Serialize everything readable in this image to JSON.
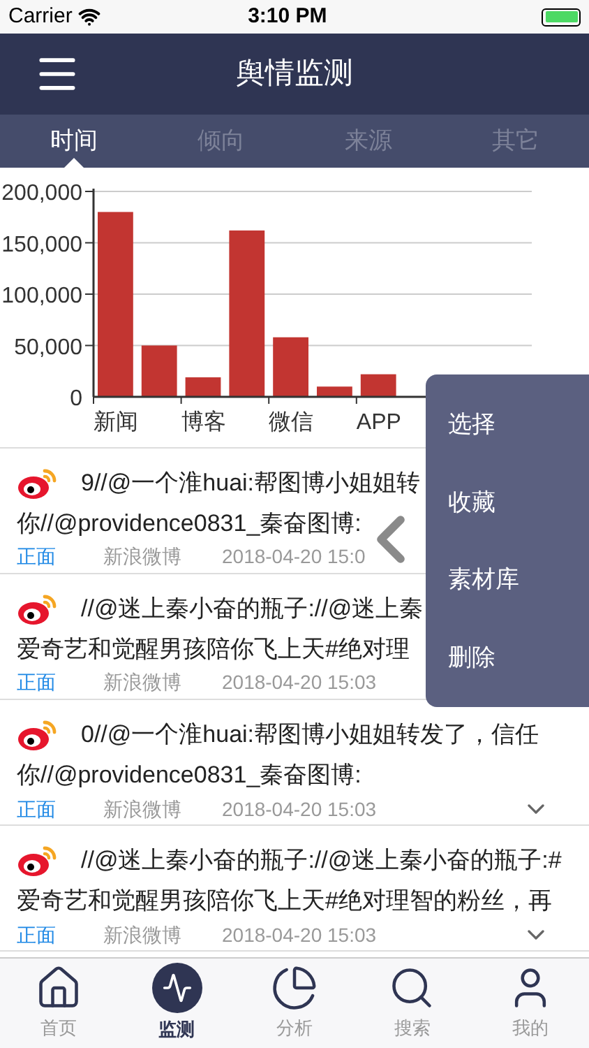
{
  "status_bar": {
    "carrier": "Carrier",
    "time": "3:10 PM"
  },
  "header": {
    "title": "舆情监测"
  },
  "tabs": [
    {
      "label": "时间",
      "selected": true
    },
    {
      "label": "倾向",
      "selected": false
    },
    {
      "label": "来源",
      "selected": false
    },
    {
      "label": "其它",
      "selected": false
    }
  ],
  "chart": {
    "chart_data": {
      "type": "bar",
      "categories": [
        "新闻",
        null,
        "博客",
        null,
        "微信",
        null,
        "APP",
        null,
        null,
        null
      ],
      "values": [
        180000,
        50000,
        19000,
        162000,
        58000,
        10000,
        22000,
        null,
        null,
        null
      ],
      "grid": true,
      "ylim": [
        0,
        200000
      ],
      "yticks": [
        {
          "value": 0,
          "label": "0"
        },
        {
          "value": 50000,
          "label": "50,000"
        },
        {
          "value": 100000,
          "label": "100,000"
        },
        {
          "value": 150000,
          "label": "150,000"
        },
        {
          "value": 200000,
          "label": "200,000"
        }
      ]
    }
  },
  "posts": [
    {
      "lines": [
        "9//@一个淮huai:帮图博小姐姐转",
        "你//@providence0831_秦奋图博:"
      ],
      "sentiment": "正面",
      "source": "新浪微博",
      "time": "2018-04-20 15:0",
      "show_expand": false
    },
    {
      "lines": [
        "//@迷上秦小奋的瓶子://@迷上秦",
        "爱奇艺和觉醒男孩陪你飞上天#绝对理"
      ],
      "sentiment": "正面",
      "source": "新浪微博",
      "time": "2018-04-20 15:03",
      "show_expand": false
    },
    {
      "lines": [
        "0//@一个淮huai:帮图博小姐姐转发了，信任",
        "你//@providence0831_秦奋图博:"
      ],
      "sentiment": "正面",
      "source": "新浪微博",
      "time": "2018-04-20 15:03",
      "show_expand": true
    },
    {
      "lines": [
        "//@迷上秦小奋的瓶子://@迷上秦小奋的瓶子:#",
        "爱奇艺和觉醒男孩陪你飞上天#绝对理智的粉丝，再"
      ],
      "sentiment": "正面",
      "source": "新浪微博",
      "time": "2018-04-20 15:03",
      "show_expand": true
    }
  ],
  "context_menu": {
    "items": [
      "选择",
      "收藏",
      "素材库",
      "删除"
    ]
  },
  "tab_bar": [
    {
      "kind": "home",
      "label": "首页",
      "selected": false
    },
    {
      "kind": "monitor",
      "label": "监测",
      "selected": true
    },
    {
      "kind": "analysis",
      "label": "分析",
      "selected": false
    },
    {
      "kind": "search",
      "label": "搜索",
      "selected": false
    },
    {
      "kind": "profile",
      "label": "我的",
      "selected": false
    }
  ]
}
